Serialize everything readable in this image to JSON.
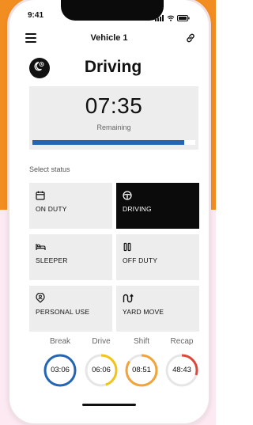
{
  "status_bar": {
    "time": "9:41"
  },
  "header": {
    "title": "Vehicle 1"
  },
  "main": {
    "title": "Driving",
    "timer": {
      "value": "07:35",
      "sub_label": "Remaining",
      "progress": 0.93
    }
  },
  "status_section": {
    "label": "Select status",
    "options": [
      {
        "label": "ON DUTY",
        "icon": "calendar-icon",
        "active": false
      },
      {
        "label": "DRIVING",
        "icon": "steering-wheel-icon",
        "active": true
      },
      {
        "label": "SLEEPER",
        "icon": "bed-icon",
        "active": false
      },
      {
        "label": "OFF DUTY",
        "icon": "pause-icon",
        "active": false
      },
      {
        "label": "PERSONAL USE",
        "icon": "person-pin-icon",
        "active": false
      },
      {
        "label": "YARD MOVE",
        "icon": "route-icon",
        "active": false
      }
    ]
  },
  "counters": [
    {
      "name": "Break",
      "value": "03:06",
      "color": "#2466b3",
      "fraction": 1.0
    },
    {
      "name": "Drive",
      "value": "06:06",
      "color": "#f2c417",
      "fraction": 0.45
    },
    {
      "name": "Shift",
      "value": "08:51",
      "color": "#f2a33a",
      "fraction": 0.85
    },
    {
      "name": "Recap",
      "value": "48:43",
      "color": "#e0473a",
      "fraction": 0.3
    }
  ],
  "colors": {
    "accent": "#2466b3",
    "background_orange": "#f28d21"
  }
}
